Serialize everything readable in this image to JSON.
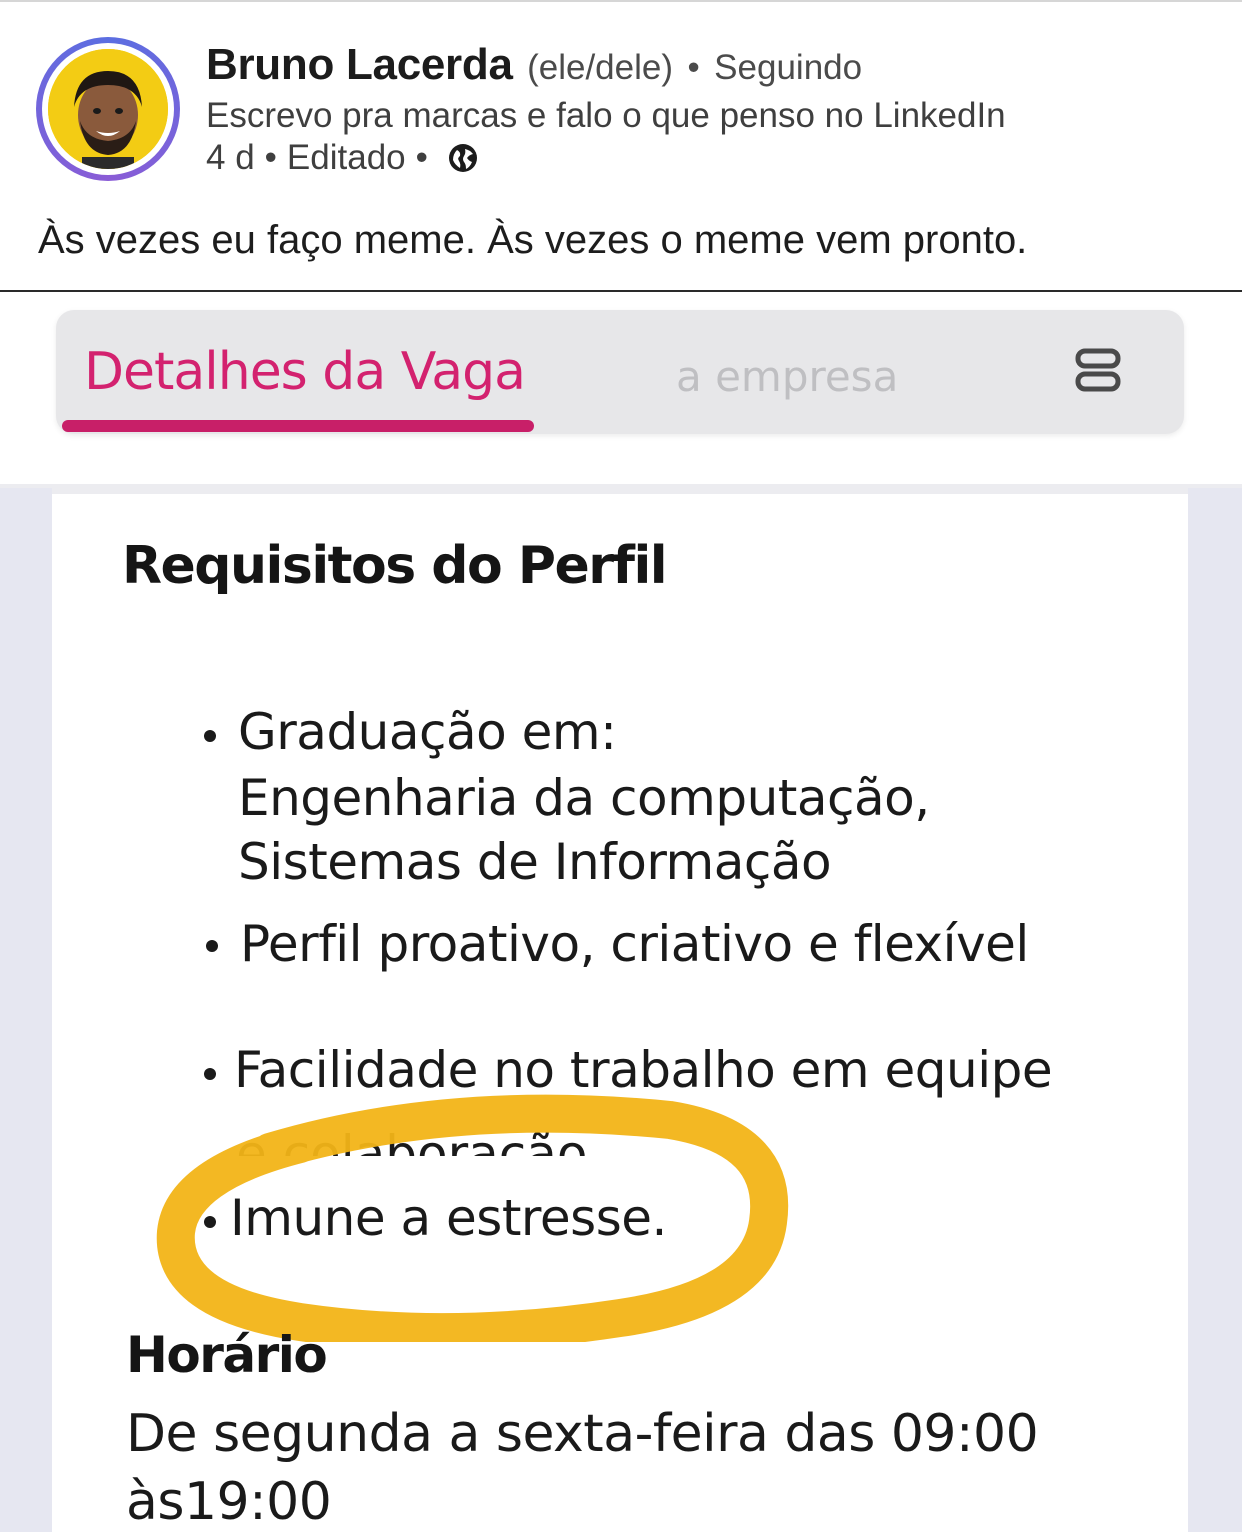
{
  "post": {
    "author": {
      "name": "Bruno Lacerda",
      "pronouns": "(ele/dele)",
      "separator": "•",
      "follow_status": "Seguindo",
      "headline": "Escrevo pra marcas e falo o que penso no LinkedIn"
    },
    "meta": {
      "age": "4 d",
      "separator": "•",
      "edited": "Editado",
      "visibility_icon": "globe-icon"
    },
    "caption": "Às vezes eu faço meme. Às vezes o meme vem pronto."
  },
  "image": {
    "tabs": [
      {
        "label": "Detalhes da Vaga",
        "active": true
      },
      {
        "label": "a empresa",
        "active": false
      }
    ],
    "menu_icon": "menu-icon",
    "section_title": "Requisitos do Perfil",
    "requirements": {
      "item1_line1": "Graduação em:",
      "item1_line2": "Engenharia da computação,",
      "item1_line3": "Sistemas de Informação",
      "item2": "Perfil proativo, criativo e flexível",
      "item3": "Facilidade no trabalho em equipe",
      "item3_cut": "e colaboração",
      "item4": "Imune a estresse."
    },
    "schedule_title": "Horário",
    "schedule_line1": "De segunda a sexta-feira das 09:00",
    "schedule_line2": "às19:00",
    "colors": {
      "accent": "#d3226f",
      "highlight": "#f2b417",
      "avatar_bg": "#f3cc14"
    }
  }
}
